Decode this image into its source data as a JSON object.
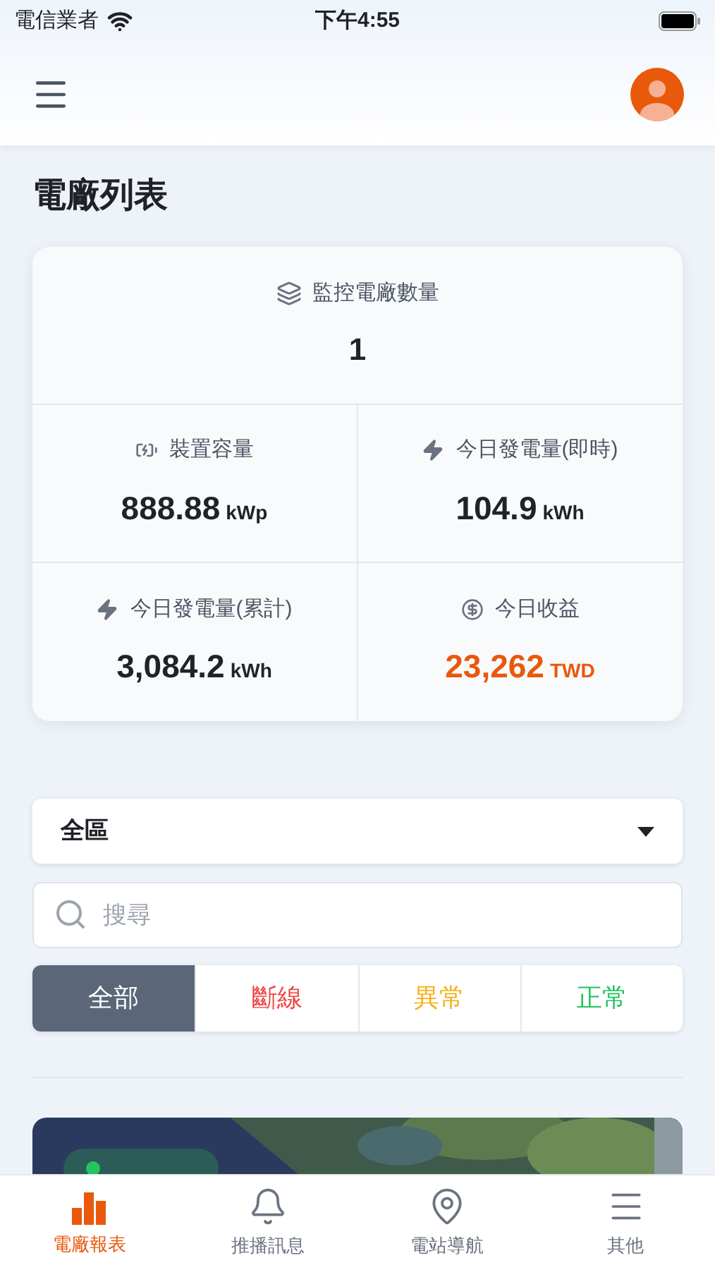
{
  "status_bar": {
    "carrier": "電信業者",
    "time": "下午4:55"
  },
  "page": {
    "title": "電廠列表"
  },
  "summary": {
    "label": "監控電廠數量",
    "value": "1",
    "stats": [
      {
        "kind": "battery",
        "label": "裝置容量",
        "value": "888.88",
        "unit": "kWp",
        "highlighted": false
      },
      {
        "kind": "bolt",
        "label": "今日發電量(即時)",
        "value": "104.9",
        "unit": "kWh",
        "highlighted": false
      },
      {
        "kind": "bolt",
        "label": "今日發電量(累計)",
        "value": "3,084.2",
        "unit": "kWh",
        "highlighted": false
      },
      {
        "kind": "coin",
        "label": "今日收益",
        "value": "23,262",
        "unit": "TWD",
        "highlighted": true
      }
    ]
  },
  "region_select": {
    "value": "全區"
  },
  "search": {
    "placeholder": "搜尋"
  },
  "filters": [
    {
      "label": "全部",
      "color": "#5b6779",
      "selected": true
    },
    {
      "label": "斷線",
      "color": "#ef4444",
      "selected": false
    },
    {
      "label": "異常",
      "color": "#f5b014",
      "selected": false
    },
    {
      "label": "正常",
      "color": "#22c55e",
      "selected": false
    }
  ],
  "plant_card": {
    "online": true
  },
  "tab_bar": [
    {
      "kind": "chart",
      "label": "電廠報表",
      "selected": true
    },
    {
      "kind": "bell",
      "label": "推播訊息",
      "selected": false
    },
    {
      "kind": "pin",
      "label": "電站導航",
      "selected": false
    },
    {
      "kind": "menu",
      "label": "其他",
      "selected": false
    }
  ]
}
